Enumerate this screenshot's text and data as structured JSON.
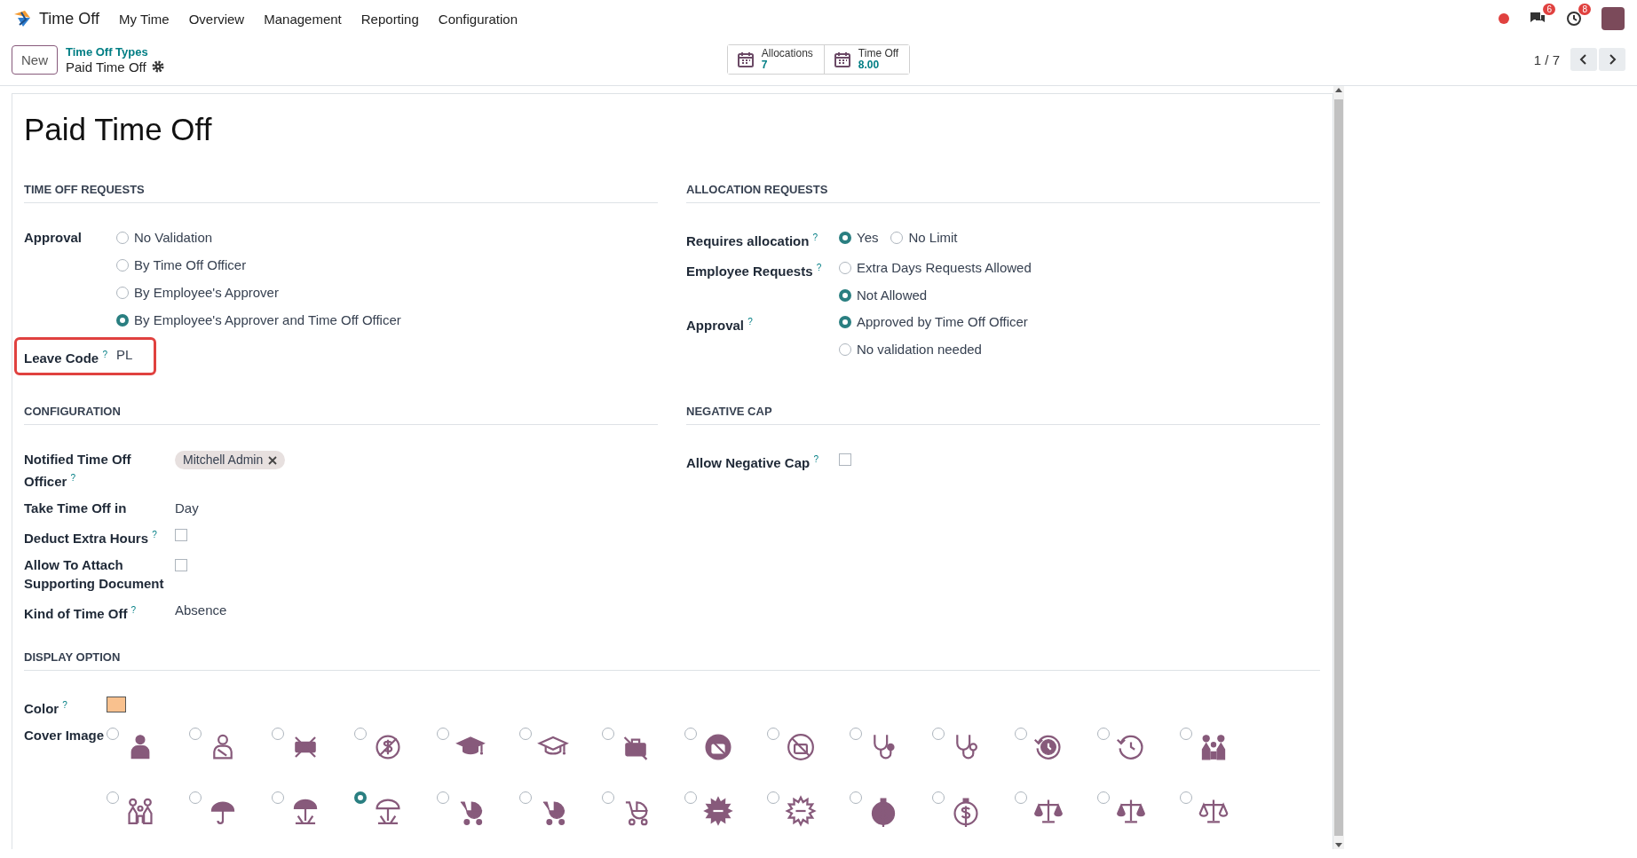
{
  "navbar": {
    "app_name": "Time Off",
    "menu": [
      "My Time",
      "Overview",
      "Management",
      "Reporting",
      "Configuration"
    ],
    "indicators": [
      {
        "kind": "messages",
        "count": "6"
      },
      {
        "kind": "activities",
        "count": "8"
      }
    ]
  },
  "control_bar": {
    "new_button": "New",
    "breadcrumb": {
      "parent": "Time Off Types",
      "current": "Paid Time Off"
    },
    "stat_buttons": [
      {
        "label": "Allocations",
        "value": "7"
      },
      {
        "label": "Time Off",
        "value": "8.00"
      }
    ],
    "pager": "1 / 7"
  },
  "record": {
    "title": "Paid Time Off",
    "section_rows": [
      [
        {
          "title": "TIME OFF REQUESTS",
          "fields": [
            {
              "kind": "radio",
              "label": "Approval",
              "options": [
                {
                  "label": "No Validation",
                  "selected": false
                },
                {
                  "label": "By Time Off Officer",
                  "selected": false
                },
                {
                  "label": "By Employee's Approver",
                  "selected": false
                },
                {
                  "label": "By Employee's Approver and Time Off Officer",
                  "selected": true
                }
              ]
            },
            {
              "kind": "text",
              "label": "Leave Code $^{?}$",
              "value": "PL",
              "highlighted": true
            }
          ]
        },
        {
          "title": "ALLOCATION REQUESTS",
          "fields": [
            {
              "kind": "radio_row",
              "label": "Requires allocation $^{?}$",
              "options": [
                {
                  "label": "Yes",
                  "selected": true
                },
                {
                  "label": "No Limit",
                  "selected": false
                }
              ]
            },
            {
              "kind": "radio",
              "label": "Employee Requests $^{?}$",
              "options": [
                {
                  "label": "Extra Days Requests Allowed",
                  "selected": false
                },
                {
                  "label": "Not Allowed",
                  "selected": true
                }
              ]
            },
            {
              "kind": "radio",
              "label": "Approval $^{?}$",
              "options": [
                {
                  "label": "Approved by Time Off Officer",
                  "selected": true
                },
                {
                  "label": "No validation needed",
                  "selected": false
                }
              ]
            }
          ]
        }
      ],
      [
        {
          "title": "CONFIGURATION",
          "fields": [
            {
              "kind": "tags",
              "label": "Notified Time Off Officer $^{?}$",
              "tags": [
                "Mitchell Admin"
              ]
            },
            {
              "kind": "text",
              "label": "Take Time Off in",
              "value": "Day",
              "highlighted": false
            },
            {
              "kind": "checkbox",
              "label": "Deduct Extra Hours $^{?}$",
              "checked": false
            },
            {
              "kind": "checkbox",
              "label": "Allow To Attach Supporting Document",
              "checked": false
            },
            {
              "kind": "text",
              "label": "Kind of Time Off $^{?}$",
              "value": "Absence",
              "highlighted": false
            }
          ]
        },
        {
          "title": "NEGATIVE CAP",
          "fields": [
            {
              "kind": "checkbox",
              "label": "Allow Negative Cap $^{?}$",
              "checked": false
            }
          ]
        }
      ],
      [
        {
          "title": "DISPLAY OPTION",
          "fields": [
            {
              "kind": "swatch",
              "label": "Color $^{?}$",
              "color": "#f9c18e"
            },
            {
              "kind": "images",
              "label": "Cover Image",
              "options": [
                {
                  "selected": false
                },
                {
                  "selected": false
                },
                {
                  "selected": false
                },
                {
                  "selected": false
                },
                {
                  "selected": false
                },
                {
                  "selected": false
                },
                {
                  "selected": false
                },
                {
                  "selected": false
                },
                {
                  "selected": false
                },
                {
                  "selected": false
                },
                {
                  "selected": false
                },
                {
                  "selected": false
                },
                {
                  "selected": false
                },
                {
                  "selected": false
                },
                {
                  "selected": false
                },
                {
                  "selected": false
                },
                {
                  "selected": false
                },
                {
                  "selected": true
                },
                {
                  "selected": false
                },
                {
                  "selected": false
                },
                {
                  "selected": false
                },
                {
                  "selected": false
                },
                {
                  "selected": false
                },
                {
                  "selected": false
                },
                {
                  "selected": false
                },
                {
                  "selected": false
                },
                {
                  "selected": false
                },
                {
                  "selected": false
                }
              ]
            }
          ]
        }
      ]
    ]
  }
}
